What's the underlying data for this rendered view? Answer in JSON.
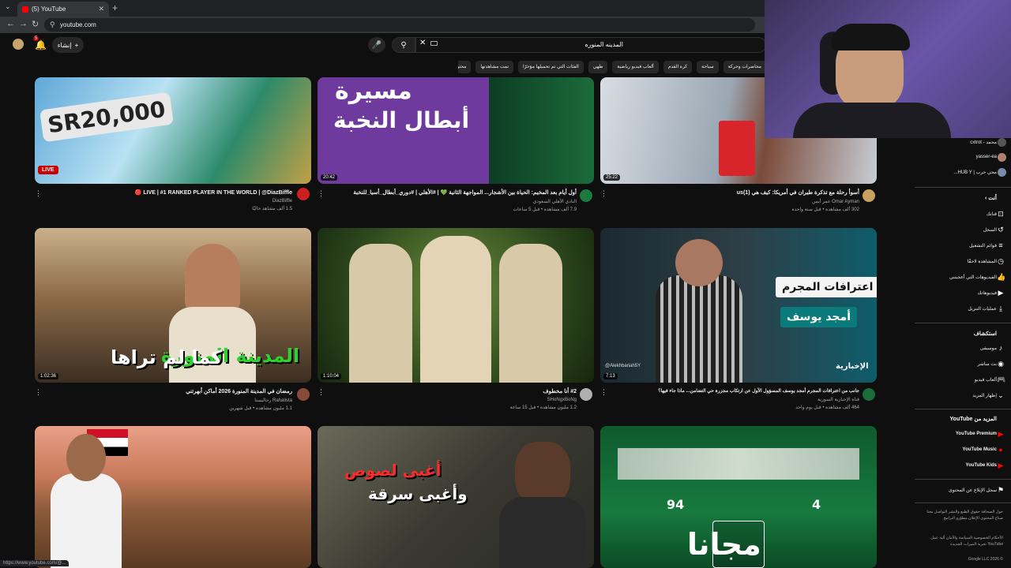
{
  "browser": {
    "tab_title": "(5) YouTube",
    "url": "youtube.com",
    "status_url": "https://www.youtube.com/@..."
  },
  "header": {
    "create_label": "إنشاء",
    "notification_count": "5",
    "search_value": "المدينه المنوره"
  },
  "chips": [
    "محاضرات وحركة",
    "سياحة",
    "كرة القدم",
    "ألعاب فيديو رياضية",
    "طهي",
    "الفئات التي تم تحميلها مؤخرًا",
    "تمت مشاهدتها",
    "محتوى جديد لك"
  ],
  "videos": [
    {
      "title": "LIVE | #1 RANKED PLAYER IN THE WORLD | @DiazBiffle 🔴",
      "channel": "DiazBiffle",
      "stats": "1.5 ألف مشاهد حاليًا",
      "duration": "",
      "live": "LIVE",
      "thumb_text": "SR20,000"
    },
    {
      "title": "أول أيام بعد المخيم: الحياة بين الأشجار... المواجهة الثانية 💚 | #الأهلي | #دوري_أبطال_أسيا_للنخبة",
      "channel": "النادي الأهلي السعودي",
      "stats": "7.9 ألف مشاهدة • قبل 5 ساعات",
      "duration": "20:42",
      "thumb_text_1": "مسيرة",
      "thumb_text_2": "أبطال النخبة"
    },
    {
      "title": "أسوأ رحلة مع تذكرة طيران في أمريكا: كيف هي (1)us",
      "channel": "Omar Ayman عمر أيمن",
      "stats": "302 ألف مشاهدة • قبل سنة واحدة",
      "duration": "25:22"
    },
    {
      "title": "رمضان في المدينة المنورة 2026 أماكن أبهرتني",
      "channel": "Rahalista رحاليستا",
      "stats": "1.1 مليون مشاهدة • قبل شهرين",
      "duration": "1:02:36",
      "thumb_text_1": "المدينة المنورة",
      "thumb_text_2": "كما لم تراها"
    },
    {
      "title": "#2 أنا مخطوف",
      "channel": "SHoNgxBoNg",
      "stats": "1.2 مليون مشاهدة • قبل 15 ساعة",
      "duration": "1:10:04"
    },
    {
      "title": "جانب من اعترافات المجرم أمجد يوسف المسؤول الأول عن ارتكاب مجزرة حي التضامن... ماذا جاء فيها؟",
      "channel": "قناة الإخبارية السورية",
      "stats": "464 ألف مشاهدة • قبل يوم واحد",
      "duration": "7:13",
      "thumb_text_1": "اعترافات المجرم",
      "thumb_text_2": "أمجد يوسف",
      "thumb_text_3": "الإخبارية",
      "thumb_handle": "@Alekhbariah5Y"
    },
    {
      "title": "",
      "channel": "",
      "stats": "",
      "duration": ""
    },
    {
      "title": "",
      "channel": "",
      "stats": "",
      "duration": "",
      "thumb_text_1": "أغبى لصوص",
      "thumb_text_2": "وأغبى سرقة"
    },
    {
      "title": "",
      "channel": "",
      "stats": "",
      "duration": "",
      "thumb_text_1": "مجانا",
      "thumb_num_1": "94",
      "thumb_num_2": "4"
    }
  ],
  "sidebar": {
    "subscriptions": [
      {
        "label": "محمد - cxtrot"
      },
      {
        "label": "yasser-ea"
      },
      {
        "label": "محي حرب | HUB Y..."
      }
    ],
    "you_heading": "أنت",
    "you_items": [
      {
        "label": "قناتك",
        "icon": "channel-icon"
      },
      {
        "label": "السجل",
        "icon": "history-icon"
      },
      {
        "label": "قوائم التشغيل",
        "icon": "playlist-icon"
      },
      {
        "label": "المشاهدة لاحقًا",
        "icon": "clock-icon"
      },
      {
        "label": "الفيديوهات التي أعجبتني",
        "icon": "like-icon"
      },
      {
        "label": "فيديوهاتك",
        "icon": "video-icon"
      },
      {
        "label": "عمليات التنزيل",
        "icon": "download-icon"
      }
    ],
    "explore_heading": "استكشاف",
    "explore_items": [
      {
        "label": "موسيقى",
        "icon": "music-icon"
      },
      {
        "label": "بث مباشر",
        "icon": "live-icon"
      },
      {
        "label": "ألعاب فيديو",
        "icon": "gaming-icon"
      },
      {
        "label": "إظهار المزيد",
        "icon": "chevron-down-icon"
      }
    ],
    "more_heading": "المزيد من YouTube",
    "more_items": [
      {
        "label": "YouTube Premium"
      },
      {
        "label": "YouTube Music"
      },
      {
        "label": "YouTube Kids"
      }
    ],
    "report_label": "سجل الإبلاغ عن المحتوى",
    "footer_1": "حول  الصحافة  حقوق الطبع والنشر  التواصل معنا  صناع المحتوى  الإعلان  مطوّرو البرامج",
    "footer_2": "الأحكام  الخصوصية  السياسة والأمان  آلية عمل YouTube  تجربة الميزات الجديدة",
    "copyright": "© 2026 Google LLC"
  },
  "colors": {
    "accent": "#ff0000",
    "bg": "#0f0f0f",
    "chip": "#272727"
  }
}
